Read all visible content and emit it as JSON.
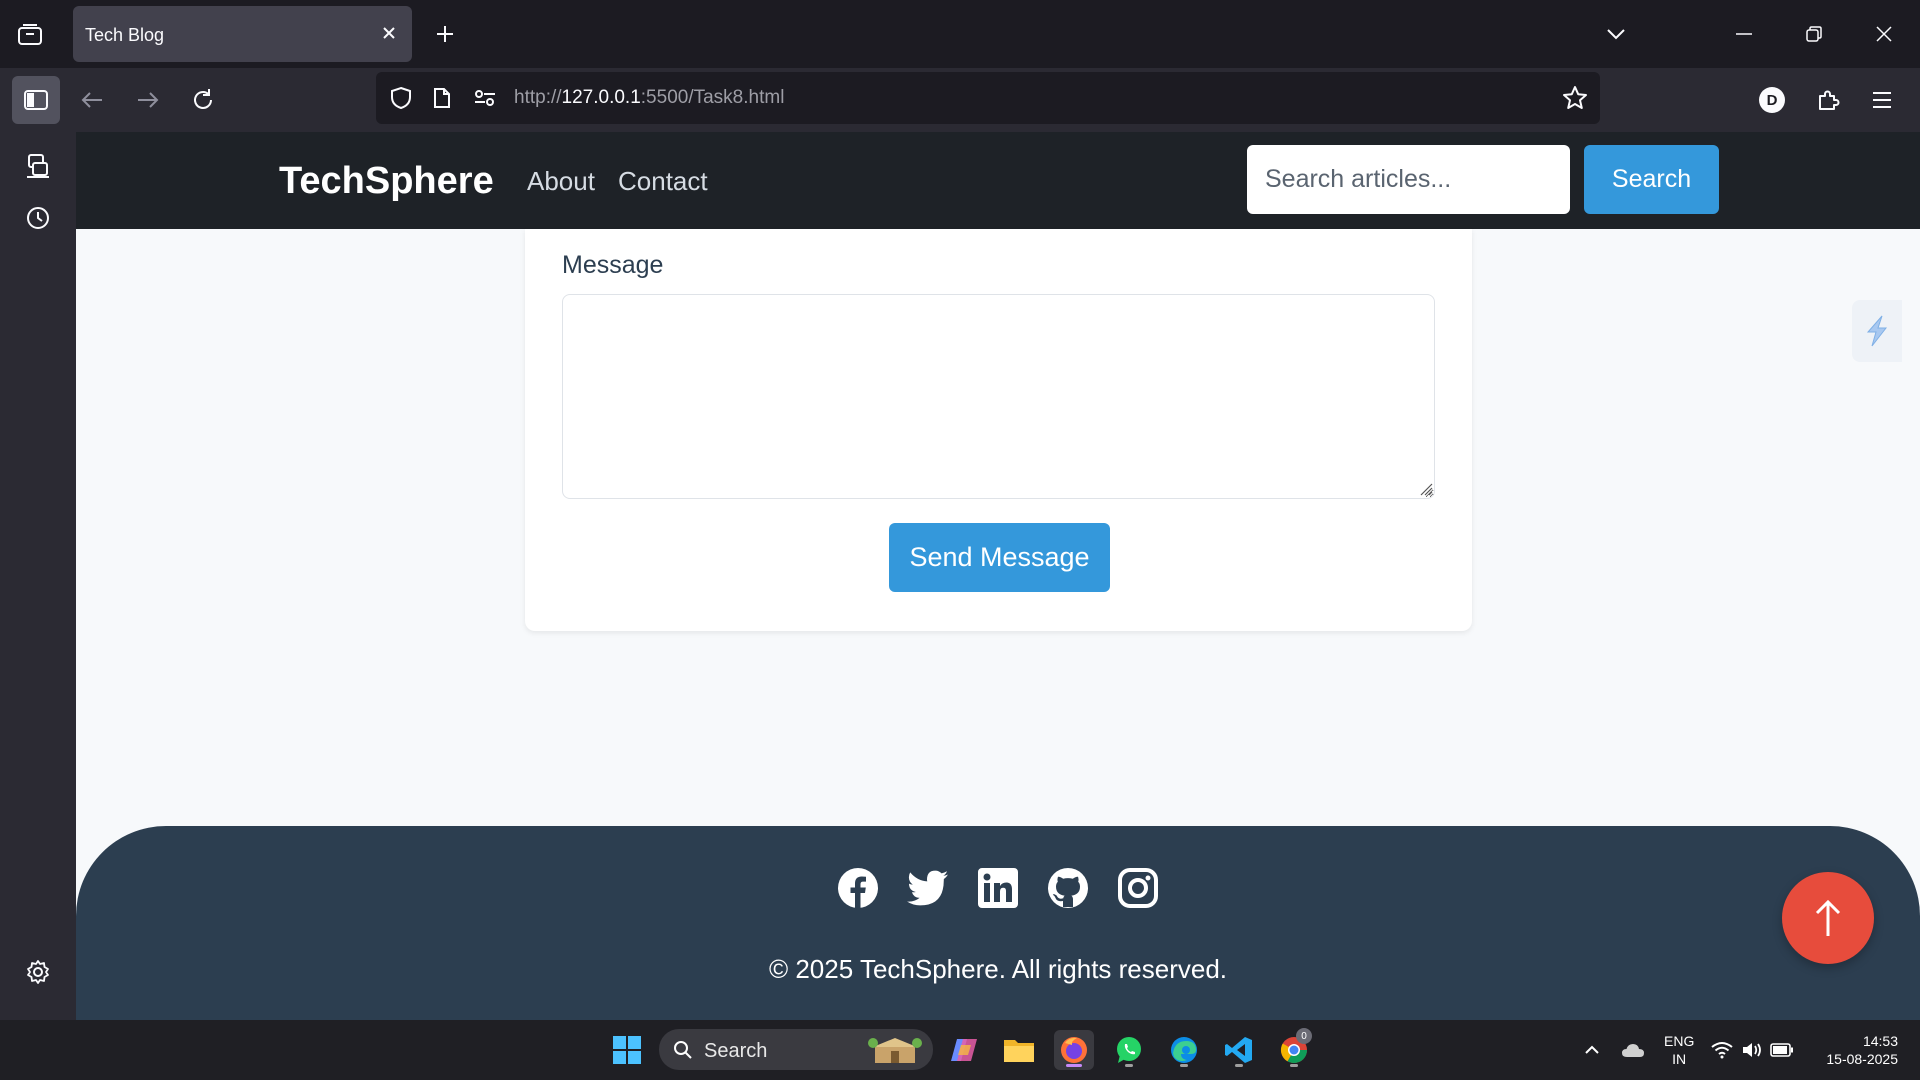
{
  "browser": {
    "tab_title": "Tech Blog",
    "url_prefix": "http://",
    "url_host": "127.0.0.1",
    "url_rest": ":5500/Task8.html",
    "profile_initial": "D"
  },
  "site": {
    "brand": "TechSphere",
    "nav": [
      "About",
      "Contact"
    ],
    "search_placeholder": "Search articles...",
    "search_button": "Search"
  },
  "form": {
    "message_label": "Message",
    "send_button": "Send Message"
  },
  "footer": {
    "social_icons": [
      "facebook-icon",
      "twitter-icon",
      "linkedin-icon",
      "github-icon",
      "instagram-icon"
    ],
    "copyright": "© 2025 TechSphere. All rights reserved."
  },
  "taskbar": {
    "search_label": "Search",
    "lang_top": "ENG",
    "lang_bottom": "IN",
    "time": "14:53",
    "date": "15-08-2025",
    "chrome_badge": "0"
  },
  "colors": {
    "accent": "#3498db",
    "header_bg": "#1e2227",
    "footer_bg": "#2c3e50",
    "to_top": "#e74c3c"
  }
}
